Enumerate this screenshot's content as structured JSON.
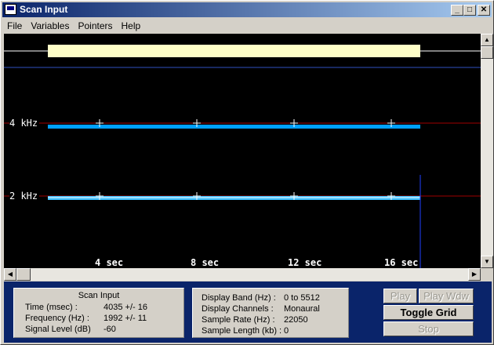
{
  "window": {
    "title": "Scan Input"
  },
  "titlebar_buttons": {
    "minimize": "_",
    "maximize": "□",
    "close": "✕"
  },
  "menu": [
    {
      "label": "File"
    },
    {
      "label": "Variables"
    },
    {
      "label": "Pointers"
    },
    {
      "label": "Help"
    }
  ],
  "plot": {
    "y_labels": [
      "4  kHz",
      "2  kHz"
    ],
    "x_labels": [
      "4  sec",
      "8  sec",
      "12  sec",
      "16  sec"
    ],
    "colors": {
      "background": "#000000",
      "trace": "#00a0ff",
      "grid": "#a00000",
      "waveform": "#ffffc8",
      "marker": "#ffffff"
    }
  },
  "scan_panel": {
    "title": "Scan Input",
    "rows": [
      {
        "label": "Time (msec) :",
        "value": "4035 +/- 16"
      },
      {
        "label": "Frequency (Hz) :",
        "value": "1992 +/- 11"
      },
      {
        "label": "Signal Level (dB)",
        "value": "-60"
      }
    ]
  },
  "display_panel": {
    "rows": [
      {
        "label": "Display Band (Hz) :",
        "value": "0 to 5512"
      },
      {
        "label": "Display Channels :",
        "value": "Monaural"
      },
      {
        "label": "Sample Rate (Hz) :",
        "value": "22050"
      },
      {
        "label": "Sample Length (kb) :",
        "value": "0"
      }
    ]
  },
  "buttons": {
    "play": "Play",
    "play_wdw": "Play Wdw",
    "toggle_grid": "Toggle Grid",
    "stop": "Stop"
  }
}
